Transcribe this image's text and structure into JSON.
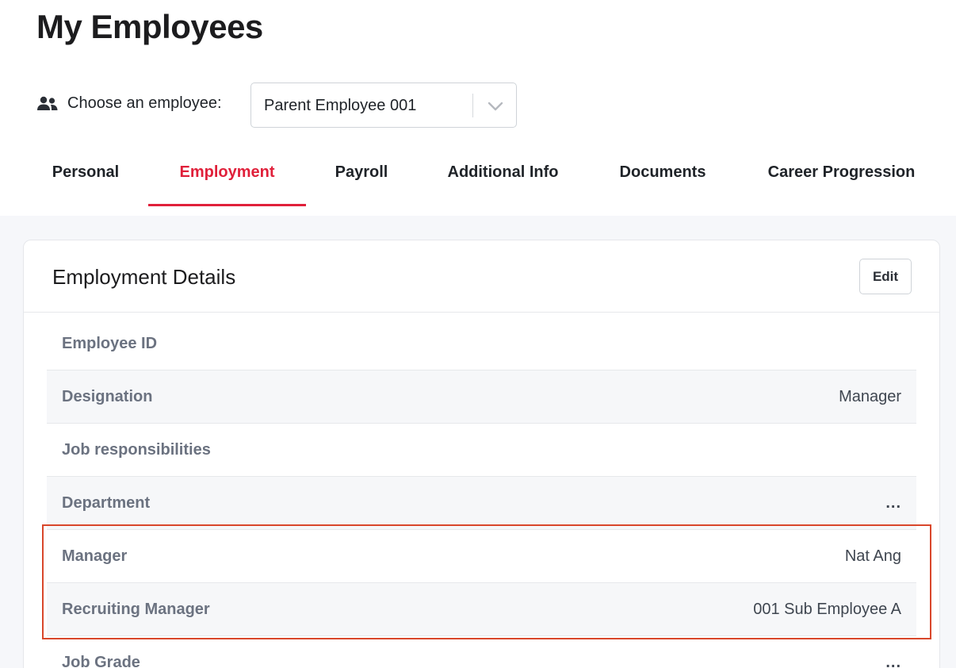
{
  "page": {
    "title": "My Employees"
  },
  "chooser": {
    "icon": "users-icon",
    "label": "Choose an employee:",
    "selected": "Parent Employee 001",
    "chevron_icon": "chevron-down-icon"
  },
  "tabs": [
    {
      "label": "Personal",
      "active": false
    },
    {
      "label": "Employment",
      "active": true
    },
    {
      "label": "Payroll",
      "active": false
    },
    {
      "label": "Additional Info",
      "active": false
    },
    {
      "label": "Documents",
      "active": false
    },
    {
      "label": "Career Progression",
      "active": false
    }
  ],
  "card": {
    "title": "Employment Details",
    "edit_label": "Edit",
    "rows": [
      {
        "label": "Employee ID",
        "value": ""
      },
      {
        "label": "Designation",
        "value": "Manager"
      },
      {
        "label": "Job responsibilities",
        "value": ""
      },
      {
        "label": "Department",
        "value": "..."
      },
      {
        "label": "Manager",
        "value": "Nat Ang"
      },
      {
        "label": "Recruiting Manager",
        "value": "001 Sub Employee A"
      },
      {
        "label": "Job Grade",
        "value": "..."
      }
    ]
  },
  "colors": {
    "accent": "#e0203a",
    "highlight_border": "#d9472b",
    "label_gray": "#6b7280",
    "page_bg": "#f6f7fa"
  }
}
